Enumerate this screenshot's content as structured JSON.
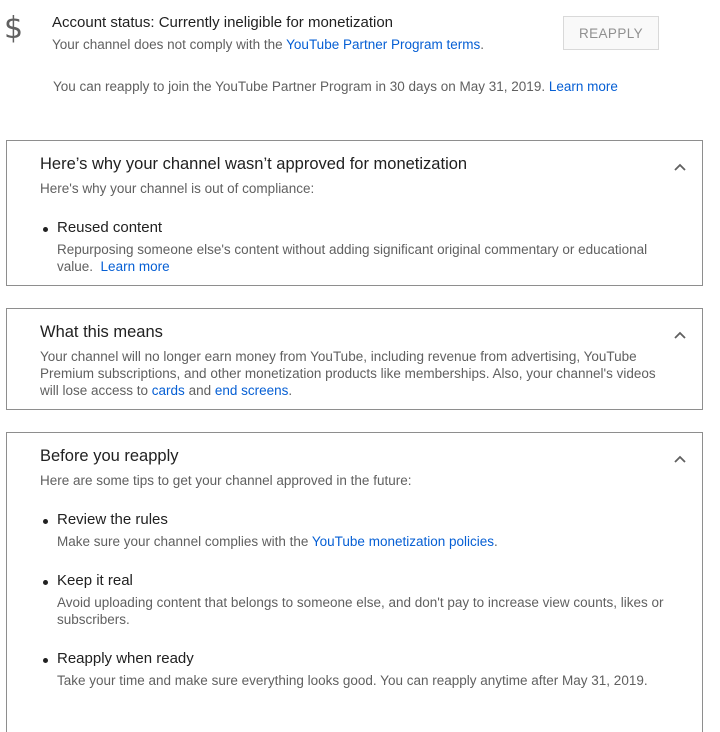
{
  "status": {
    "icon": "dollar-icon",
    "title": "Account status: Currently ineligible for monetization",
    "desc_prefix": "Your channel does not comply with the ",
    "desc_link": "YouTube Partner Program terms",
    "desc_suffix": ".",
    "reapply_button": "REAPPLY",
    "note_text": "You can reapply to join the YouTube Partner Program in 30 days on May 31, 2019.",
    "note_link": "Learn more"
  },
  "card_why": {
    "title": "Here’s why your channel wasn’t approved for monetization",
    "subtitle": "Here's why your channel is out of compliance:",
    "items": [
      {
        "title": "Reused content",
        "desc_line1": "Repurposing someone else's content without adding significant original commentary or educational",
        "desc_line2": "value.",
        "link": "Learn more"
      }
    ]
  },
  "card_means": {
    "title": "What this means",
    "line1": "Your channel will no longer earn money from YouTube, including revenue from advertising, YouTube",
    "line2": "Premium subscriptions, and other monetization products like memberships. Also, your channel's videos",
    "line3_prefix": "will lose access to ",
    "link_cards": "cards",
    "and": " and ",
    "link_end_screens": "end screens",
    "line3_suffix": "."
  },
  "card_before": {
    "title": "Before you reapply",
    "subtitle": "Here are some tips to get your channel approved in the future:",
    "items": [
      {
        "title": "Review the rules",
        "desc_prefix": "Make sure your channel complies with the ",
        "desc_link": "YouTube monetization policies",
        "desc_suffix": "."
      },
      {
        "title": "Keep it real",
        "desc_line1": "Avoid uploading content that belongs to someone else, and don't pay to increase view counts, likes or",
        "desc_line2": "subscribers."
      },
      {
        "title": "Reapply when ready",
        "desc": "Take your time and make sure everything looks good. You can reapply anytime after May 31, 2019."
      }
    ]
  },
  "colors": {
    "link": "#065fd4",
    "primary_text": "#212121",
    "secondary_text": "#606060",
    "border": "#8e8e8e"
  }
}
